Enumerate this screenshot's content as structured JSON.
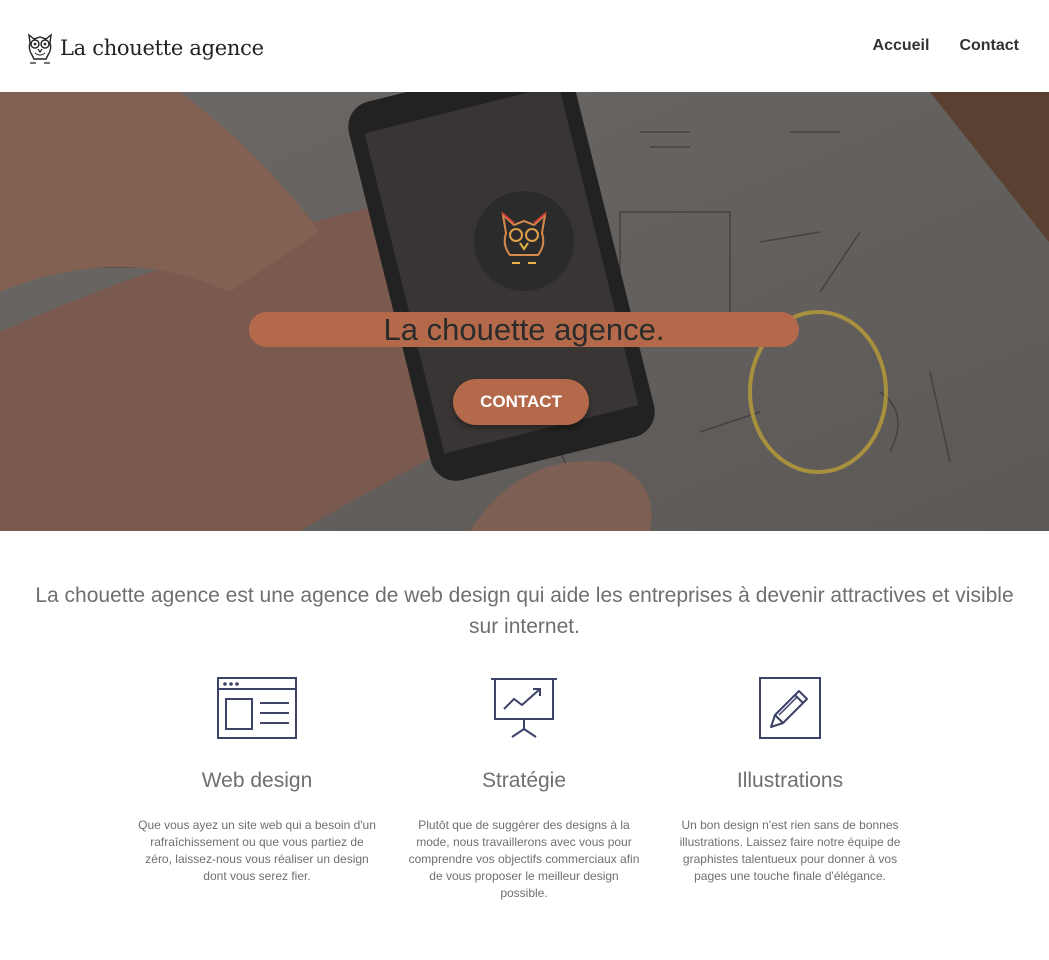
{
  "header": {
    "logo_text": "La chouette agence",
    "nav": [
      {
        "label": "Accueil"
      },
      {
        "label": "Contact"
      }
    ]
  },
  "hero": {
    "title": "La chouette agence.",
    "button_label": "CONTACT"
  },
  "intro": {
    "text": "La chouette agence est une agence de web design qui aide les entreprises à devenir attractives et visible sur internet."
  },
  "services": [
    {
      "icon": "browser-window-icon",
      "title": "Web design",
      "text": "Que vous ayez un site web qui a besoin d'un rafraîchissement ou que vous partiez de zéro, laissez-nous vous réaliser un design dont vous serez fier."
    },
    {
      "icon": "presentation-chart-icon",
      "title": "Stratégie",
      "text": "Plutôt que de suggérer des designs à la mode, nous travaillerons avec vous pour comprendre vos objectifs commerciaux afin de vous proposer le meilleur design possible."
    },
    {
      "icon": "pencil-square-icon",
      "title": "Illustrations",
      "text": "Un bon design n'est rien sans de bonnes illustrations. Laissez faire notre équipe de graphistes talentueux pour donner à vos pages une touche finale d'élégance."
    }
  ],
  "colors": {
    "accent": "#b4694a",
    "text": "#6f6f6f",
    "icon": "#3d4268"
  }
}
